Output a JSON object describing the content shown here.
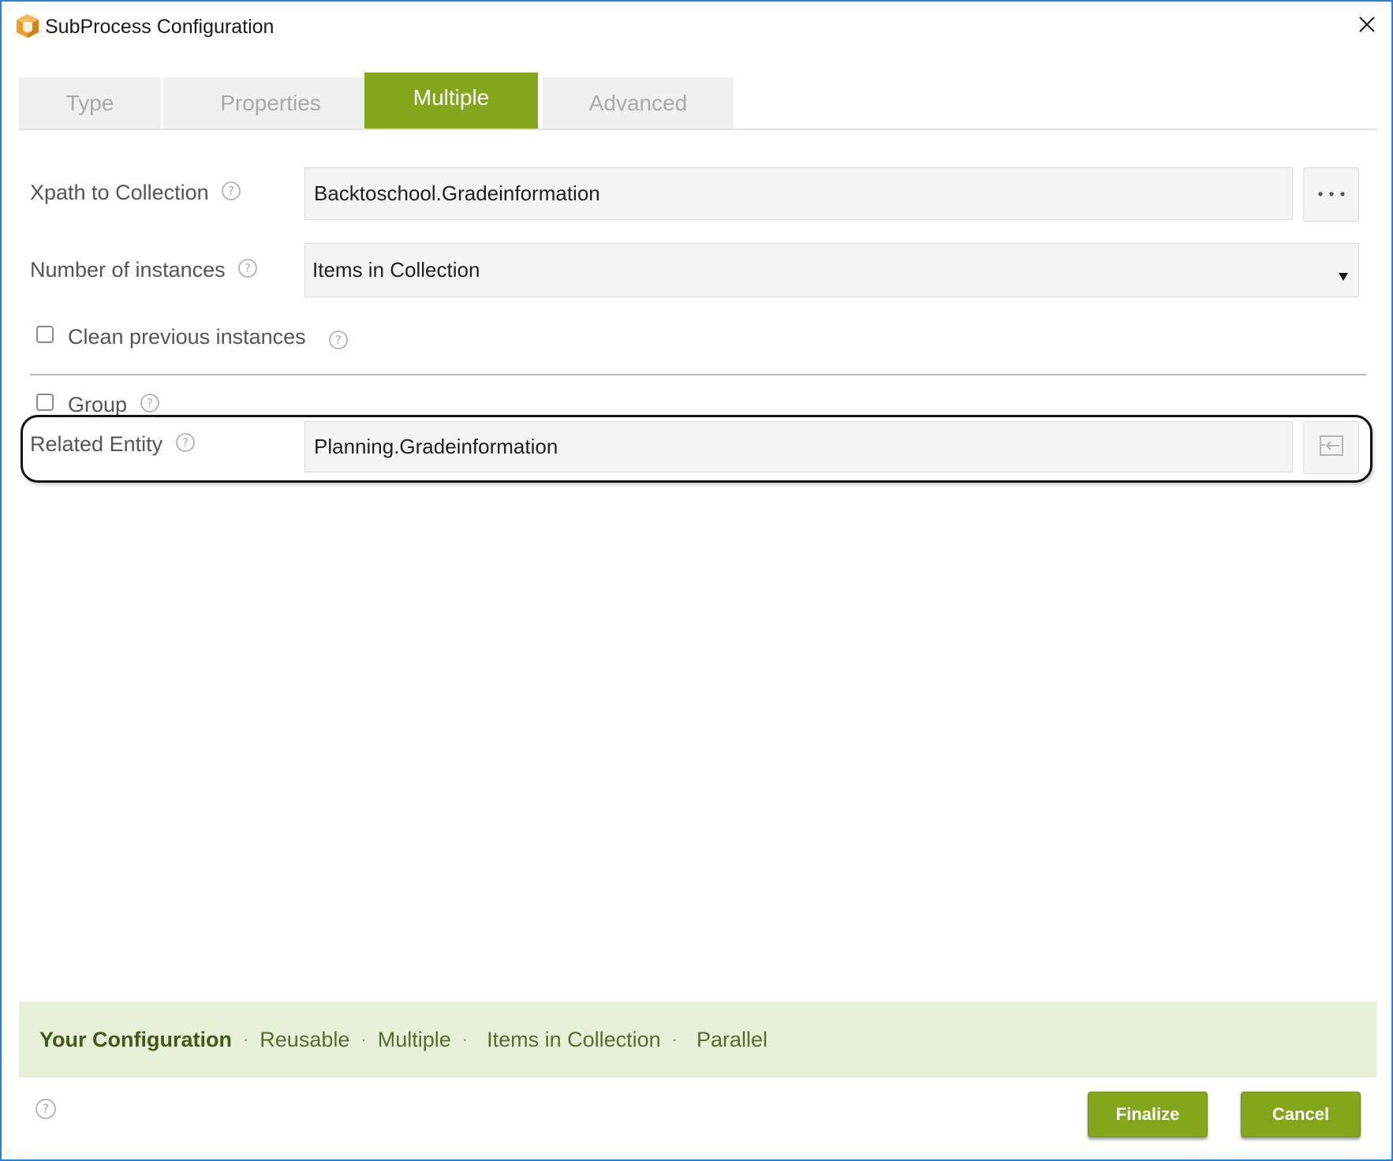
{
  "window": {
    "title": "SubProcess Configuration",
    "icon": "app-cube-icon",
    "close_icon": "close-icon"
  },
  "tabs": [
    {
      "label": "Type",
      "active": false
    },
    {
      "label": "Properties",
      "active": false
    },
    {
      "label": "Multiple",
      "active": true
    },
    {
      "label": "Advanced",
      "active": false
    }
  ],
  "form": {
    "xpath": {
      "label": "Xpath to Collection",
      "value": "Backtoschool.Gradeinformation",
      "button_label": "..."
    },
    "instances": {
      "label": "Number of instances",
      "value": "Items in Collection"
    },
    "clean": {
      "label": "Clean previous instances",
      "checked": false
    },
    "group": {
      "label": "Group",
      "checked": false
    },
    "related": {
      "label": "Related Entity",
      "value": "Planning.Gradeinformation",
      "button_icon": "back-arrow-icon"
    }
  },
  "summary": {
    "title": "Your Configuration",
    "items": [
      "Reusable",
      "Multiple",
      "Items in Collection",
      "Parallel"
    ]
  },
  "footer": {
    "finalize_label": "Finalize",
    "cancel_label": "Cancel"
  },
  "colors": {
    "accent": "#84a61a",
    "window_border": "#2b7fd4",
    "summary_bg": "#e9f0d8",
    "icon_orange": "#f39c1f"
  }
}
